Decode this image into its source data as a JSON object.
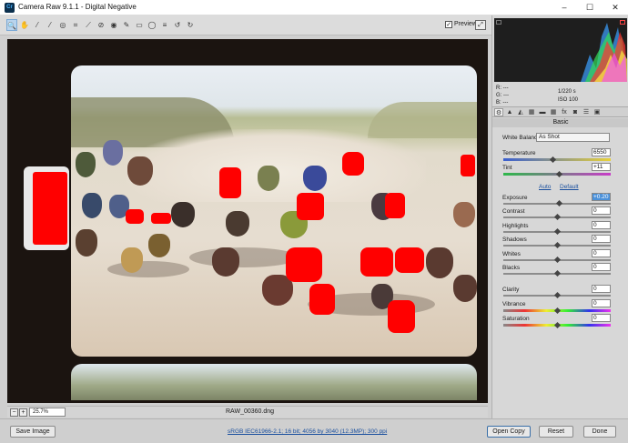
{
  "window": {
    "app_icon_text": "Cr",
    "title": "Camera Raw 9.1.1  -  Digital Negative",
    "minimize": "–",
    "maximize": "☐",
    "close": "✕"
  },
  "toolbar": {
    "tools": [
      "zoom-tool",
      "hand-tool",
      "white-balance-tool",
      "color-sampler-tool",
      "targeted-adjustment-tool",
      "crop-tool",
      "straighten-tool",
      "spot-removal-tool",
      "red-eye-tool",
      "adjustment-brush-tool",
      "graduated-filter-tool",
      "radial-filter-tool",
      "open-preferences",
      "rotate-left",
      "rotate-right"
    ],
    "tool_glyphs": [
      "🔍",
      "✋",
      "⁄",
      "⁄",
      "◎",
      "⌗",
      "⟋",
      "⊘",
      "◉",
      "✎",
      "▭",
      "◯",
      "≡",
      "↺",
      "↻"
    ],
    "preview_checked": "✓",
    "preview_label": "Preview",
    "fullscreen_glyph": "⤢"
  },
  "canvas": {
    "background": "#1b1410",
    "clipping_color": "#ff0000"
  },
  "status": {
    "zoom_out_glyph": "−",
    "zoom_in_glyph": "+",
    "zoom_level": "25.7%",
    "filename": "RAW_00360.dng"
  },
  "footer": {
    "save_label": "Save Image",
    "workflow_link": "sRGB IEC61966-2.1; 16 bit; 4056 by 3040 (12.3MP); 300 ppi",
    "open_label": "Open Copy",
    "reset_label": "Reset",
    "done_label": "Done"
  },
  "histogram": {
    "r_label": "R:",
    "g_label": "G:",
    "b_label": "B:",
    "r_value": "---",
    "g_value": "---",
    "b_value": "---",
    "shutter": "1/220 s",
    "iso": "ISO 100"
  },
  "panel": {
    "tab_glyphs": [
      "⚙",
      "▲",
      "◭",
      "▦",
      "▬",
      "▦",
      "fx",
      "◙",
      "☰",
      "▣"
    ],
    "section_title": "Basic",
    "white_balance_label": "White Balance:",
    "white_balance_value": "As Shot",
    "temperature_label": "Temperature",
    "temperature_value": "6550",
    "tint_label": "Tint",
    "tint_value": "+11",
    "auto_label": "Auto",
    "default_label": "Default",
    "exposure_label": "Exposure",
    "exposure_value": "+0.20",
    "contrast_label": "Contrast",
    "contrast_value": "0",
    "highlights_label": "Highlights",
    "highlights_value": "0",
    "shadows_label": "Shadows",
    "shadows_value": "0",
    "whites_label": "Whites",
    "whites_value": "0",
    "blacks_label": "Blacks",
    "blacks_value": "0",
    "clarity_label": "Clarity",
    "clarity_value": "0",
    "vibrance_label": "Vibrance",
    "vibrance_value": "0",
    "saturation_label": "Saturation",
    "saturation_value": "0"
  }
}
